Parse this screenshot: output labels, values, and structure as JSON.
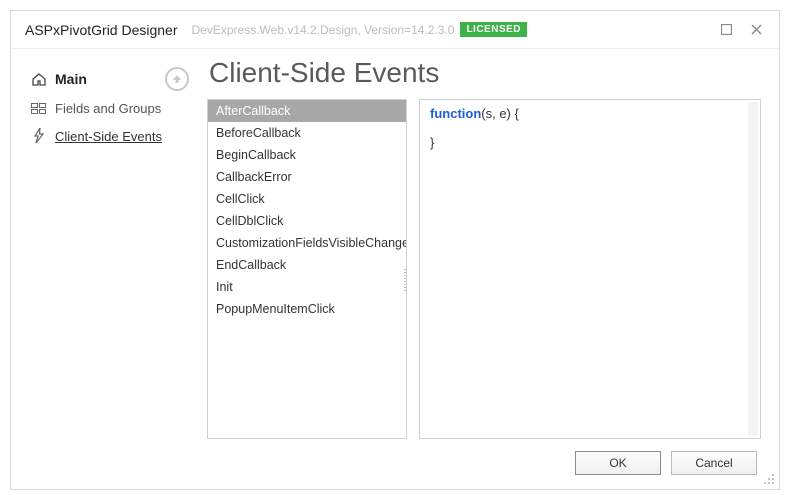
{
  "window": {
    "title": "ASPxPivotGrid Designer",
    "version": "DevExpress.Web.v14.2.Design, Version=14.2.3.0",
    "license_badge": "LICENSED"
  },
  "sidebar": {
    "main_label": "Main",
    "items": [
      {
        "label": "Fields and Groups",
        "active": false
      },
      {
        "label": "Client-Side Events",
        "active": true
      }
    ]
  },
  "page": {
    "title": "Client-Side Events"
  },
  "events": [
    "AfterCallback",
    "BeforeCallback",
    "BeginCallback",
    "CallbackError",
    "CellClick",
    "CellDblClick",
    "CustomizationFieldsVisibleChanged",
    "EndCallback",
    "Init",
    "PopupMenuItemClick"
  ],
  "selected_event_index": 0,
  "code": {
    "keyword": "function",
    "signature": "(s, e) {",
    "close": "}"
  },
  "buttons": {
    "ok": "OK",
    "cancel": "Cancel"
  }
}
